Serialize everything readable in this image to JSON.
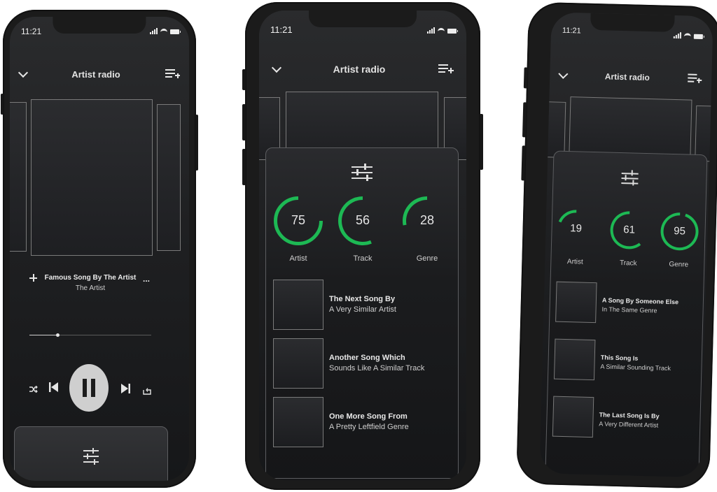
{
  "status_time": "11:21",
  "header_title": "Artist radio",
  "phone1": {
    "now_playing": {
      "title": "Famous Song By The Artist",
      "artist": "The Artist",
      "more": "..."
    },
    "progress": 0.23
  },
  "phone2": {
    "dials": [
      {
        "label": "Artist",
        "value": "75"
      },
      {
        "label": "Track",
        "value": "56"
      },
      {
        "label": "Genre",
        "value": "28"
      }
    ],
    "songs": [
      {
        "title": "The Next Song By",
        "subtitle": "A Very Similar Artist"
      },
      {
        "title": "Another Song Which",
        "subtitle": "Sounds Like A Similar Track"
      },
      {
        "title": "One More Song From",
        "subtitle": "A Pretty Leftfield Genre"
      }
    ]
  },
  "phone3": {
    "dials": [
      {
        "label": "Artist",
        "value": "19"
      },
      {
        "label": "Track",
        "value": "61"
      },
      {
        "label": "Genre",
        "value": "95"
      }
    ],
    "songs": [
      {
        "title": "A Song By Someone Else",
        "subtitle": "In The Same Genre"
      },
      {
        "title": "This Song Is",
        "subtitle": "A Similar Sounding Track"
      },
      {
        "title": "The Last Song Is By",
        "subtitle": "A Very Different Artist"
      }
    ]
  },
  "colors": {
    "accent_green": "#1db954",
    "background": "#1f2022"
  },
  "icons": [
    "chevron-down-icon",
    "queue-add-icon",
    "tune-icon",
    "shuffle-icon",
    "previous-icon",
    "pause-icon",
    "next-icon",
    "repeat-icon",
    "plus-icon"
  ]
}
